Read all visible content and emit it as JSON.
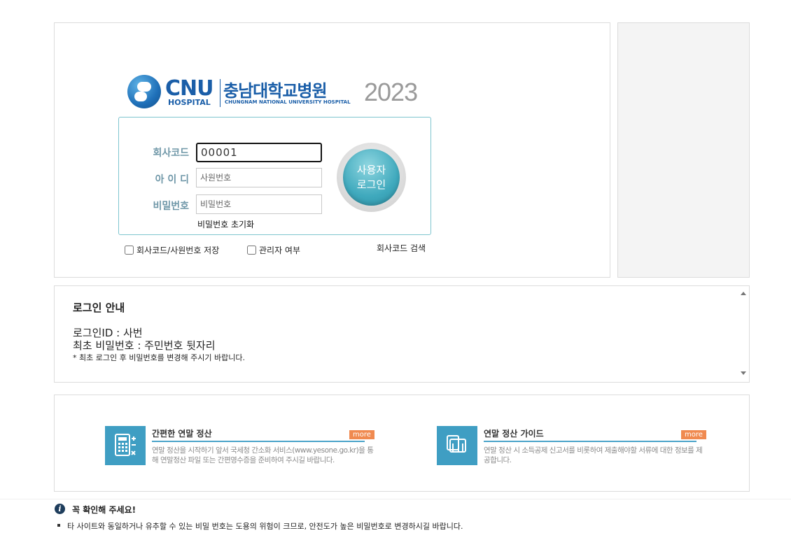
{
  "logo": {
    "cnu": "CNU",
    "hospital": "HOSPITAL",
    "name_ko": "충남대학교병원",
    "name_en": "CHUNGNAM NATIONAL UNIVERSITY HOSPITAL",
    "year": "2023"
  },
  "login": {
    "company_code_label": "회사코드",
    "company_code_value": "00001",
    "id_label": "아 이 디",
    "id_placeholder": "사원번호",
    "password_label": "비밀번호",
    "password_placeholder": "비밀번호",
    "reset_password": "비밀번호 초기화",
    "login_button_line1": "사용자",
    "login_button_line2": "로그인",
    "save_checkbox_label": "회사코드/사원번호 저장",
    "admin_checkbox_label": "관리자 여부",
    "company_search": "회사코드 검색"
  },
  "notice": {
    "title": "로그인 안내",
    "line1": "로그인ID : 사번",
    "line2": "최초 비밀번호 : 주민번호 뒷자리",
    "line3": "* 최초 로그인 후 비밀번호를 변경해 주시기 바랍니다."
  },
  "guides": [
    {
      "title": "간편한 연말 정산",
      "more": "more",
      "desc": "연말 정산을 시작하기 앞서 국세청 간소화 서비스(www.yesone.go.kr)을 통해 연말정산 파일 또는 간편영수증을 준비하여 주시길 바랍니다.",
      "icon": "calculator-icon"
    },
    {
      "title": "연말 정산 가이드",
      "more": "more",
      "desc": "연말 정산 시 소득공제 신고서를 비롯하여 제출해야할 서류에 대한 정보를 제공합니다.",
      "icon": "book-icon"
    }
  ],
  "footer": {
    "title": "꼭 확인해 주세요!",
    "text": "타 사이트와 동일하거나 유추할 수 있는 비밀 번호는 도용의 위험이 크므로, 안전도가 높은 비밀번호로 변경하시길 바랍니다."
  },
  "colors": {
    "accent": "#3fa9bd",
    "brand": "#1a5ea8",
    "more": "#f08a50",
    "label": "#6f97a8"
  }
}
